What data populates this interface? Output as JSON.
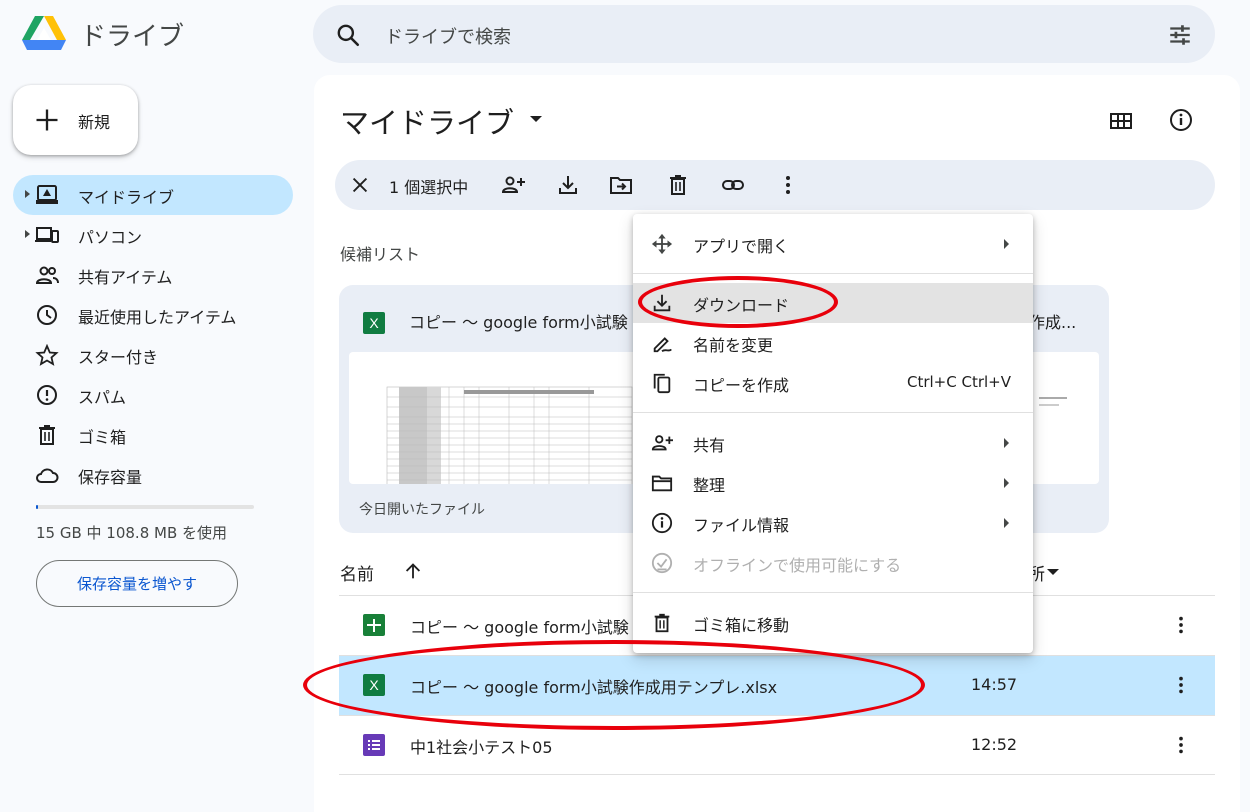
{
  "app": {
    "title": "ドライブ"
  },
  "search": {
    "placeholder": "ドライブで検索"
  },
  "sidebar": {
    "new_label": "新規",
    "items": [
      {
        "label": "マイドライブ",
        "icon": "my-drive-icon"
      },
      {
        "label": "パソコン",
        "icon": "computers-icon"
      },
      {
        "label": "共有アイテム",
        "icon": "shared-icon"
      },
      {
        "label": "最近使用したアイテム",
        "icon": "clock-icon"
      },
      {
        "label": "スター付き",
        "icon": "star-icon"
      },
      {
        "label": "スパム",
        "icon": "spam-icon"
      },
      {
        "label": "ゴミ箱",
        "icon": "trash-icon"
      },
      {
        "label": "保存容量",
        "icon": "cloud-icon"
      }
    ],
    "storage_text": "15 GB 中 108.8 MB を使用",
    "storage_used_fraction": 0.0071,
    "storage_button": "保存容量を増やす"
  },
  "main": {
    "title": "マイドライブ",
    "selection_count": "1 個選択中",
    "suggested_label": "候補リスト",
    "card": {
      "title": "コピー ～ google form小試験",
      "title_tail": "作成...",
      "subtitle": "今日開いたファイル"
    },
    "columns": {
      "name": "名前",
      "location": "所"
    },
    "files": [
      {
        "name": "コピー ～ google form小試験",
        "time": "",
        "type": "sheets"
      },
      {
        "name": "コピー ～ google form小試験作成用テンプレ.xlsx",
        "time": "14:57",
        "type": "excel"
      },
      {
        "name": "中1社会小テスト05",
        "time": "12:52",
        "type": "forms"
      }
    ]
  },
  "context_menu": {
    "items": [
      {
        "label": "アプリで開く",
        "icon": "open-with-icon",
        "submenu": true
      },
      {
        "label": "ダウンロード",
        "icon": "download-icon"
      },
      {
        "label": "名前を変更",
        "icon": "rename-icon"
      },
      {
        "label": "コピーを作成",
        "icon": "copy-icon",
        "shortcut": "Ctrl+C Ctrl+V"
      },
      {
        "label": "共有",
        "icon": "share-icon",
        "submenu": true
      },
      {
        "label": "整理",
        "icon": "folder-icon",
        "submenu": true
      },
      {
        "label": "ファイル情報",
        "icon": "info-icon",
        "submenu": true
      },
      {
        "label": "オフラインで使用可能にする",
        "icon": "offline-icon",
        "disabled": true
      },
      {
        "label": "ゴミ箱に移動",
        "icon": "trash-icon"
      }
    ]
  },
  "colors": {
    "accent": "#0b57d0",
    "selected": "#c2e7ff",
    "annotation": "#e8000b",
    "excel": "#107c41",
    "sheets": "#188038",
    "forms": "#673ab7"
  }
}
